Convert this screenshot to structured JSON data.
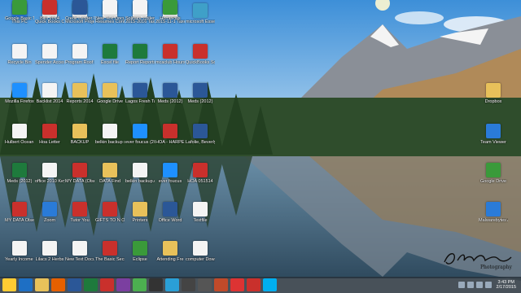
{
  "taskbar": {
    "clock_time": "3:43 PM",
    "clock_date": "2/17/2015"
  },
  "watermark": {
    "text": "Photography"
  },
  "desktop": {
    "icons": [
      {
        "label": "This PC",
        "type": "blue"
      },
      {
        "label": "Quick Books Concepts",
        "type": "doc"
      },
      {
        "label": "Microsoft Project Manag...",
        "type": "doc"
      },
      {
        "label": "Resumes Contac...",
        "type": "doc"
      },
      {
        "label": "2015-2016 Taxes",
        "type": "doc"
      },
      {
        "label": "2015-11-1 Taxes",
        "type": "doc"
      },
      {
        "label": "microsoft Essentials Report",
        "type": "teal"
      },
      {
        "label": "Recycle Bin",
        "type": "doc"
      },
      {
        "label": "Spender Access",
        "type": "doc"
      },
      {
        "label": "Program Roof 2014",
        "type": "doc"
      },
      {
        "label": "Excel file",
        "type": "xl"
      },
      {
        "label": "Report Reports Data",
        "type": "xl"
      },
      {
        "label": "mcaclub Hours 2014",
        "type": "pdf"
      },
      {
        "label": "QuickBooks Software 2012",
        "type": "pdf"
      },
      {
        "label": "Mozilla Firefox",
        "type": "ie"
      },
      {
        "label": "Backlist 2014",
        "type": "doc"
      },
      {
        "label": "Reports 2014",
        "type": "folder"
      },
      {
        "label": "Google Drive",
        "type": "folder"
      },
      {
        "label": "Lagos Fresh Table",
        "type": "wd"
      },
      {
        "label": "Meds (2012)",
        "type": "wd"
      },
      {
        "label": "Meds (2012)",
        "type": "wd"
      },
      {
        "label": "Hulbert Ocean...",
        "type": "doc"
      },
      {
        "label": "Hoa Letter",
        "type": "pdf"
      },
      {
        "label": "BACKUP",
        "type": "folder"
      },
      {
        "label": "belkin backup (2014_11...",
        "type": "doc"
      },
      {
        "label": "ever foucus (2014_11...",
        "type": "ie"
      },
      {
        "label": "HOA - HARPER...",
        "type": "pdf"
      },
      {
        "label": "Lafolie, Beverly",
        "type": "wd"
      },
      {
        "label": "Meds (2012)",
        "type": "xl"
      },
      {
        "label": "office 2010 Key",
        "type": "doc"
      },
      {
        "label": "MY DATA (Olsen...",
        "type": "pdf"
      },
      {
        "label": "DATA Find",
        "type": "folder"
      },
      {
        "label": "belkin backup.com",
        "type": "doc"
      },
      {
        "label": "ever foucus",
        "type": "ie"
      },
      {
        "label": "HOA 051514",
        "type": "pdf"
      },
      {
        "label": "MY DATA Olsen",
        "type": "pdf"
      },
      {
        "label": "Zoom",
        "type": "blue"
      },
      {
        "label": "Tutor You",
        "type": "pdf"
      },
      {
        "label": "GIFTS TO N OLSEN 1",
        "type": "pdf"
      },
      {
        "label": "Printers",
        "type": "folder"
      },
      {
        "label": "Office Word",
        "type": "wd"
      },
      {
        "label": "Textfile",
        "type": "doc"
      },
      {
        "label": "Yearly Income 2014",
        "type": "doc"
      },
      {
        "label": "Lilacs 2 Herbs",
        "type": "doc"
      },
      {
        "label": "New Text Document",
        "type": "doc"
      },
      {
        "label": "The Basic Secrets",
        "type": "pdf"
      },
      {
        "label": "Eclipse",
        "type": "green"
      },
      {
        "label": "Attending Fre",
        "type": "folder"
      },
      {
        "label": "computer Downloads",
        "type": "doc"
      },
      {
        "label": "Google Basic Training",
        "type": "green"
      },
      {
        "label": "Bills 2014",
        "type": "pdf"
      },
      {
        "label": "Credit Lender Meeting",
        "type": "wd"
      },
      {
        "label": "New Text Document",
        "type": "doc"
      },
      {
        "label": "Solitaire Collection",
        "type": "doc"
      },
      {
        "label": "HomePals",
        "type": "green"
      },
      {
        "label": "Dropbox",
        "type": "folder"
      },
      {
        "label": "Team Viewer",
        "type": "blue"
      },
      {
        "label": "Google Drive",
        "type": "green"
      },
      {
        "label": "Malwarebytes Anti-Malware",
        "type": "blue"
      }
    ]
  },
  "pinned": [
    "Explorer",
    "Outlook",
    "Folders",
    "Firefox",
    "Word",
    "Excel",
    "QuickBooks",
    "Picasa",
    "Chrome",
    "Media",
    "Store",
    "Music",
    "Mic",
    "Print",
    "Teams",
    "Video",
    "Skype"
  ]
}
